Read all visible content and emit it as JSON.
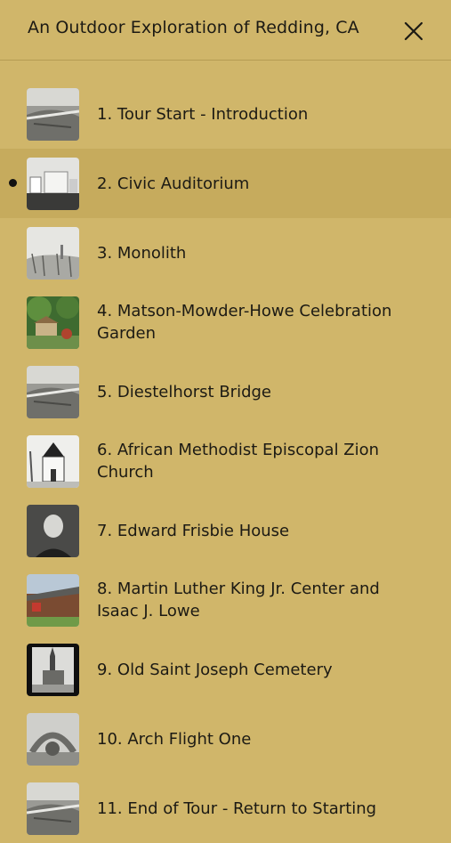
{
  "header": {
    "title": "An Outdoor Exploration of Redding, CA",
    "close_icon": "close-icon"
  },
  "stops": [
    {
      "label": "1. Tour Start - Introduction",
      "active": false,
      "thumb": "b"
    },
    {
      "label": "2. Civic Auditorium",
      "active": true,
      "thumb": "c"
    },
    {
      "label": "3. Monolith",
      "active": false,
      "thumb": "f"
    },
    {
      "label": "4. Matson-Mowder-Howe Celebration Garden",
      "active": false,
      "thumb": "g"
    },
    {
      "label": "5. Diestelhorst Bridge",
      "active": false,
      "thumb": "b"
    },
    {
      "label": "6. African Methodist Episcopal Zion Church",
      "active": false,
      "thumb": "h"
    },
    {
      "label": "7. Edward Frisbie House",
      "active": false,
      "thumb": "p"
    },
    {
      "label": "8. Martin Luther King Jr. Center and Isaac J. Lowe",
      "active": false,
      "thumb": "k"
    },
    {
      "label": "9. Old Saint Joseph Cemetery",
      "active": false,
      "thumb": "s"
    },
    {
      "label": "10. Arch Flight One",
      "active": false,
      "thumb": "a"
    },
    {
      "label": "11. End of Tour - Return to Starting",
      "active": false,
      "thumb": "b"
    }
  ],
  "colors": {
    "background": "#d0b66a",
    "active_row": "#c6ab5d",
    "text": "#1c1a14"
  }
}
